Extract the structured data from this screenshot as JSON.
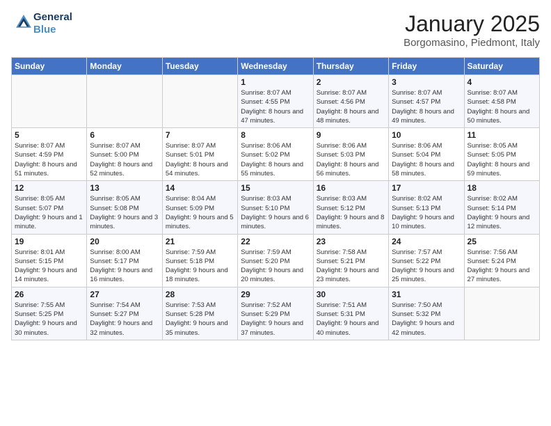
{
  "logo": {
    "line1": "General",
    "line2": "Blue"
  },
  "title": "January 2025",
  "subtitle": "Borgomasino, Piedmont, Italy",
  "days_header": [
    "Sunday",
    "Monday",
    "Tuesday",
    "Wednesday",
    "Thursday",
    "Friday",
    "Saturday"
  ],
  "weeks": [
    [
      {
        "day": "",
        "info": ""
      },
      {
        "day": "",
        "info": ""
      },
      {
        "day": "",
        "info": ""
      },
      {
        "day": "1",
        "info": "Sunrise: 8:07 AM\nSunset: 4:55 PM\nDaylight: 8 hours\nand 47 minutes."
      },
      {
        "day": "2",
        "info": "Sunrise: 8:07 AM\nSunset: 4:56 PM\nDaylight: 8 hours\nand 48 minutes."
      },
      {
        "day": "3",
        "info": "Sunrise: 8:07 AM\nSunset: 4:57 PM\nDaylight: 8 hours\nand 49 minutes."
      },
      {
        "day": "4",
        "info": "Sunrise: 8:07 AM\nSunset: 4:58 PM\nDaylight: 8 hours\nand 50 minutes."
      }
    ],
    [
      {
        "day": "5",
        "info": "Sunrise: 8:07 AM\nSunset: 4:59 PM\nDaylight: 8 hours\nand 51 minutes."
      },
      {
        "day": "6",
        "info": "Sunrise: 8:07 AM\nSunset: 5:00 PM\nDaylight: 8 hours\nand 52 minutes."
      },
      {
        "day": "7",
        "info": "Sunrise: 8:07 AM\nSunset: 5:01 PM\nDaylight: 8 hours\nand 54 minutes."
      },
      {
        "day": "8",
        "info": "Sunrise: 8:06 AM\nSunset: 5:02 PM\nDaylight: 8 hours\nand 55 minutes."
      },
      {
        "day": "9",
        "info": "Sunrise: 8:06 AM\nSunset: 5:03 PM\nDaylight: 8 hours\nand 56 minutes."
      },
      {
        "day": "10",
        "info": "Sunrise: 8:06 AM\nSunset: 5:04 PM\nDaylight: 8 hours\nand 58 minutes."
      },
      {
        "day": "11",
        "info": "Sunrise: 8:05 AM\nSunset: 5:05 PM\nDaylight: 8 hours\nand 59 minutes."
      }
    ],
    [
      {
        "day": "12",
        "info": "Sunrise: 8:05 AM\nSunset: 5:07 PM\nDaylight: 9 hours\nand 1 minute."
      },
      {
        "day": "13",
        "info": "Sunrise: 8:05 AM\nSunset: 5:08 PM\nDaylight: 9 hours\nand 3 minutes."
      },
      {
        "day": "14",
        "info": "Sunrise: 8:04 AM\nSunset: 5:09 PM\nDaylight: 9 hours\nand 5 minutes."
      },
      {
        "day": "15",
        "info": "Sunrise: 8:03 AM\nSunset: 5:10 PM\nDaylight: 9 hours\nand 6 minutes."
      },
      {
        "day": "16",
        "info": "Sunrise: 8:03 AM\nSunset: 5:12 PM\nDaylight: 9 hours\nand 8 minutes."
      },
      {
        "day": "17",
        "info": "Sunrise: 8:02 AM\nSunset: 5:13 PM\nDaylight: 9 hours\nand 10 minutes."
      },
      {
        "day": "18",
        "info": "Sunrise: 8:02 AM\nSunset: 5:14 PM\nDaylight: 9 hours\nand 12 minutes."
      }
    ],
    [
      {
        "day": "19",
        "info": "Sunrise: 8:01 AM\nSunset: 5:15 PM\nDaylight: 9 hours\nand 14 minutes."
      },
      {
        "day": "20",
        "info": "Sunrise: 8:00 AM\nSunset: 5:17 PM\nDaylight: 9 hours\nand 16 minutes."
      },
      {
        "day": "21",
        "info": "Sunrise: 7:59 AM\nSunset: 5:18 PM\nDaylight: 9 hours\nand 18 minutes."
      },
      {
        "day": "22",
        "info": "Sunrise: 7:59 AM\nSunset: 5:20 PM\nDaylight: 9 hours\nand 20 minutes."
      },
      {
        "day": "23",
        "info": "Sunrise: 7:58 AM\nSunset: 5:21 PM\nDaylight: 9 hours\nand 23 minutes."
      },
      {
        "day": "24",
        "info": "Sunrise: 7:57 AM\nSunset: 5:22 PM\nDaylight: 9 hours\nand 25 minutes."
      },
      {
        "day": "25",
        "info": "Sunrise: 7:56 AM\nSunset: 5:24 PM\nDaylight: 9 hours\nand 27 minutes."
      }
    ],
    [
      {
        "day": "26",
        "info": "Sunrise: 7:55 AM\nSunset: 5:25 PM\nDaylight: 9 hours\nand 30 minutes."
      },
      {
        "day": "27",
        "info": "Sunrise: 7:54 AM\nSunset: 5:27 PM\nDaylight: 9 hours\nand 32 minutes."
      },
      {
        "day": "28",
        "info": "Sunrise: 7:53 AM\nSunset: 5:28 PM\nDaylight: 9 hours\nand 35 minutes."
      },
      {
        "day": "29",
        "info": "Sunrise: 7:52 AM\nSunset: 5:29 PM\nDaylight: 9 hours\nand 37 minutes."
      },
      {
        "day": "30",
        "info": "Sunrise: 7:51 AM\nSunset: 5:31 PM\nDaylight: 9 hours\nand 40 minutes."
      },
      {
        "day": "31",
        "info": "Sunrise: 7:50 AM\nSunset: 5:32 PM\nDaylight: 9 hours\nand 42 minutes."
      },
      {
        "day": "",
        "info": ""
      }
    ]
  ]
}
